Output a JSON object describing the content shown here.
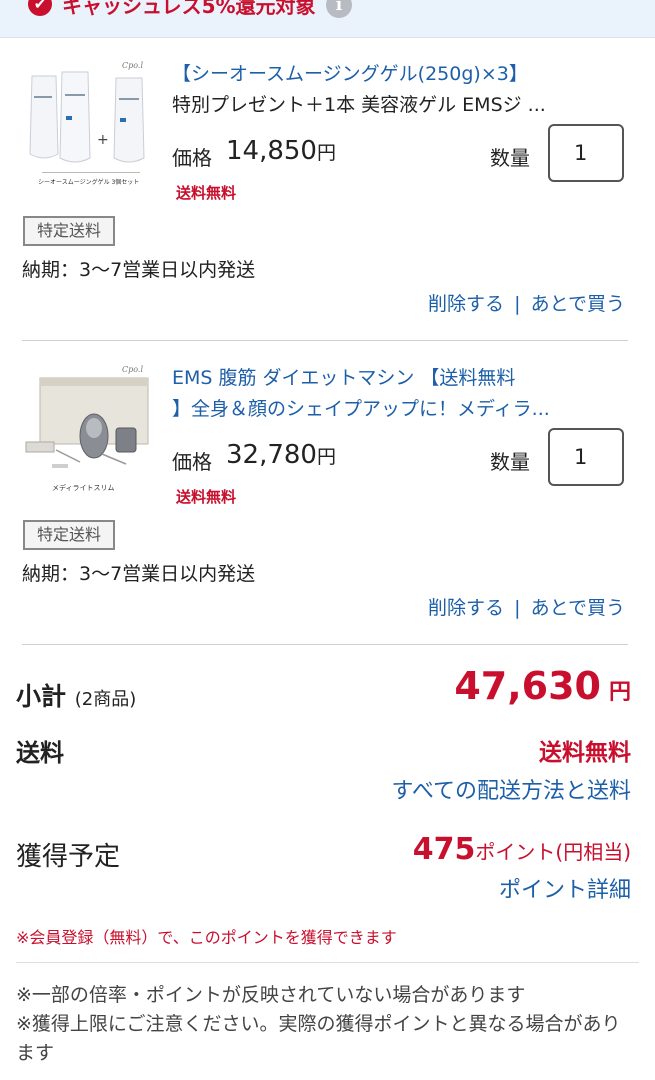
{
  "banner": {
    "check_glyph": "✔",
    "text": "キャッシュレス5%還元対象",
    "info_glyph": "i"
  },
  "items": [
    {
      "title_line1": "【シーオースムージングゲル(250g)×3】",
      "title_line2": "特別プレゼント＋1本 美容液ゲル EMSジ ...",
      "price_label": "価格",
      "price": "14,850",
      "yen": "円",
      "shipping_free": "送料無料",
      "qty_label": "数量",
      "qty": "1",
      "badge": "特定送料",
      "delivery": "納期：3〜7営業日以内発送",
      "delete": "削除する",
      "later": "あとで買う",
      "sep": "|",
      "thumb_caption1": "シーオースムージングゲル 3個セット",
      "thumb_brand": "Cpo.l"
    },
    {
      "title_line1": "EMS 腹筋 ダイエットマシン 【送料無料",
      "title_line2": "】全身＆顔のシェイプアップに！メディラ...",
      "price_label": "価格",
      "price": "32,780",
      "yen": "円",
      "shipping_free": "送料無料",
      "qty_label": "数量",
      "qty": "1",
      "badge": "特定送料",
      "delivery": "納期：3〜7営業日以内発送",
      "delete": "削除する",
      "later": "あとで買う",
      "sep": "|",
      "thumb_caption1": "メディライトスリム",
      "thumb_brand": "Cpo.l"
    }
  ],
  "summary": {
    "subtotal_label": "小計",
    "subtotal_count": "(2商品)",
    "subtotal_value": "47,630",
    "subtotal_yen": "円",
    "shipping_label": "送料",
    "shipping_value": "送料無料",
    "shipping_link": "すべての配送方法と送料",
    "earn_label": "獲得予定",
    "earn_points": "475",
    "earn_unit": "ポイント(円相当)",
    "point_detail_link": "ポイント詳細",
    "member_note": "※会員登録（無料）で、このポイントを獲得できます",
    "note1": "※一部の倍率・ポイントが反映されていない場合があります",
    "note2": "※獲得上限にご注意ください。実際の獲得ポイントと異なる場合があります"
  },
  "colors": {
    "price_red": "#c8102e",
    "link_blue": "#1d5fa8",
    "banner_bg": "#eaf2fb"
  }
}
